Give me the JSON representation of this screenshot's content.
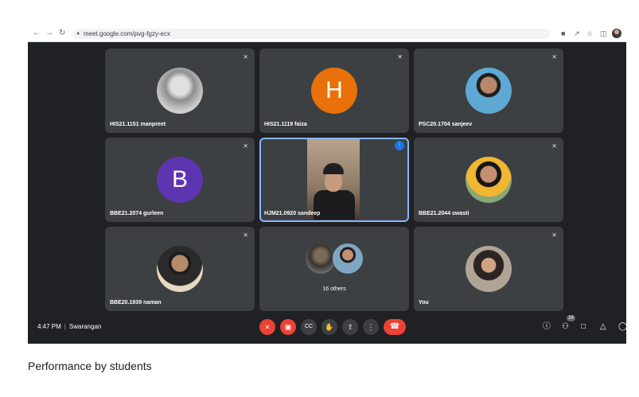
{
  "browser": {
    "url": "meet.google.com/pvg-fgzy-ecx",
    "icons": [
      "back-icon",
      "forward-icon",
      "reload-icon",
      "lock-icon",
      "camera-icon",
      "share-icon",
      "star-icon",
      "sidebar-icon",
      "profile-icon"
    ]
  },
  "participants": [
    {
      "name": "HIS21.1151 manpreet"
    },
    {
      "name": "HIS21.1119 faiza",
      "initial": "H",
      "color": "#e8710a"
    },
    {
      "name": "PSC20.1704 sanjeev"
    },
    {
      "name": "BBE21.2074 gurleen",
      "initial": "B",
      "color": "#5e35b1"
    },
    {
      "name": "HJM21.0920 sandeep"
    },
    {
      "name": "BBE21.2044 swasti"
    },
    {
      "name": "BBE20.1939 naman"
    },
    {
      "name": "16 others"
    },
    {
      "name": "You"
    }
  ],
  "bottom_bar": {
    "time": "4:47 PM",
    "meeting_name": "Swarangan",
    "participant_count": "24"
  },
  "caption": "Performance by students",
  "colors": {
    "background": "#202124",
    "tile": "#3c4043",
    "danger": "#ea4335",
    "active_speaker": "#1a73e8"
  }
}
